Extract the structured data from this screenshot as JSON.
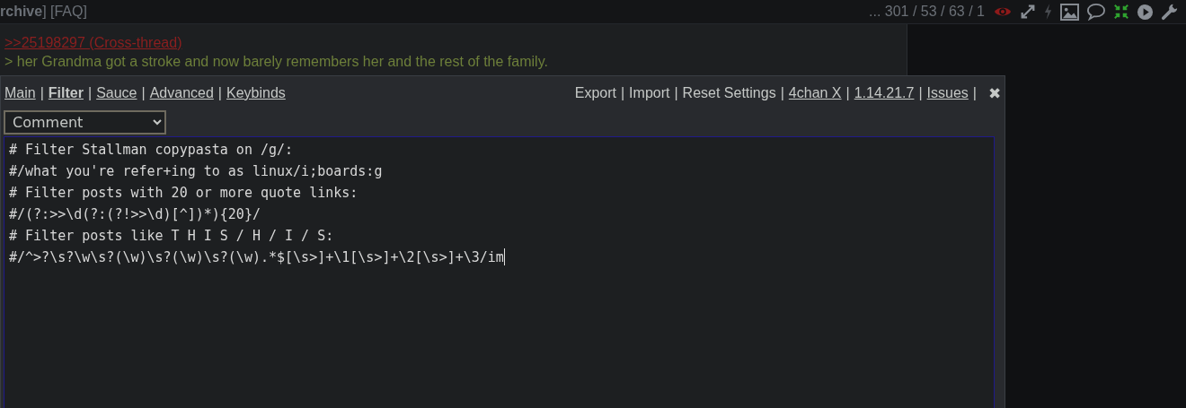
{
  "top_bar": {
    "nav_text": "**rchive**] [FAQ]",
    "counts": "... 301 / 53 / 63 / 1",
    "icons": [
      {
        "kind": "eye"
      },
      {
        "kind": "expand"
      },
      {
        "kind": "bolt"
      },
      {
        "kind": "image"
      },
      {
        "kind": "bubble"
      },
      {
        "kind": "shrink"
      },
      {
        "kind": "play"
      },
      {
        "kind": "wrench"
      }
    ]
  },
  "post": {
    "quote_link": ">>25198297 (Cross-thread)",
    "greentext": "> her Grandma got a stroke and now barely remembers her and the rest of the family."
  },
  "settings_dialog": {
    "tabs": [
      {
        "label": "Main",
        "selected": false,
        "separator": "|"
      },
      {
        "label": "Filter",
        "selected": true,
        "separator": "|"
      },
      {
        "label": "Sauce",
        "selected": false,
        "separator": "|"
      },
      {
        "label": "Advanced",
        "selected": false,
        "separator": "|"
      },
      {
        "label": "Keybinds",
        "selected": false
      }
    ],
    "actions": [
      {
        "label": "Export",
        "kind": "plain",
        "separator": "|"
      },
      {
        "label": "Import",
        "kind": "plain",
        "separator": "|"
      },
      {
        "label": "Reset Settings",
        "kind": "plain",
        "separator": "|"
      },
      {
        "label": "4chan X",
        "kind": "link",
        "separator": "|"
      },
      {
        "label": "1.14.21.7",
        "kind": "link",
        "separator": "|"
      },
      {
        "label": "Issues",
        "kind": "link",
        "separator": "|"
      }
    ],
    "close": "✖",
    "filter_type": "Comment",
    "filter_lines": [
      "# Filter Stallman copypasta on /g/:",
      "#/what you're refer+ing to as linux/i;boards:g",
      "# Filter posts with 20 or more quote links:",
      "#/(?:>>\\d(?:(?!>>\\d)[^])*){20}/",
      "# Filter posts like T H I S / H / I / S:",
      "#/^>?\\s?\\w\\s?(\\w)\\s?(\\w)\\s?(\\w).*$[\\s>]+\\1[\\s>]+\\2[\\s>]+\\3/im"
    ]
  }
}
